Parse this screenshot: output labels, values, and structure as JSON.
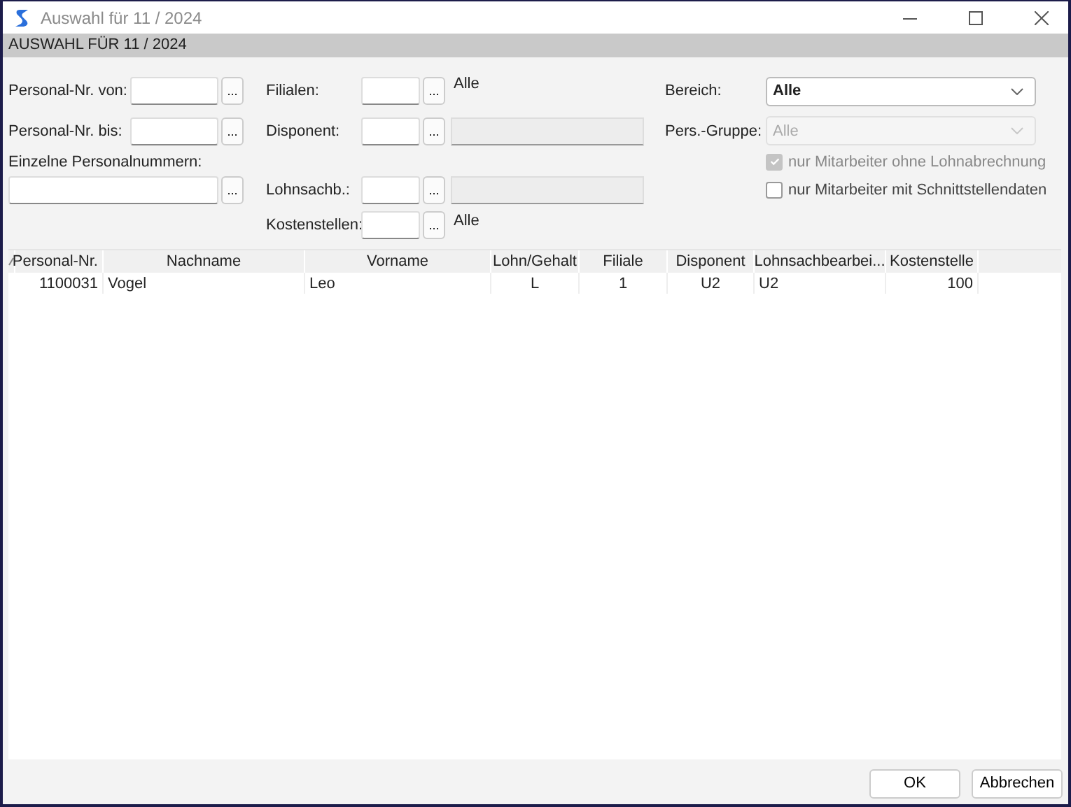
{
  "window": {
    "title": "Auswahl für 11 / 2024"
  },
  "header": "AUSWAHL FÜR 11 / 2024",
  "left_fields": [
    {
      "label": "Personal-Nr. von:",
      "browse": "..."
    },
    {
      "label": "Personal-Nr. bis:",
      "browse": "..."
    },
    {
      "label": "Einzelne Personalnummern:",
      "browse": "..."
    }
  ],
  "middle_fields": [
    {
      "label": "Filialen:",
      "browse": "...",
      "kind": "note",
      "note": "Alle"
    },
    {
      "label": "Disponent:",
      "browse": "...",
      "kind": "detail"
    },
    {
      "label": "Lohnsachb.:",
      "browse": "...",
      "kind": "detail"
    },
    {
      "label": "Kostenstellen:",
      "browse": "...",
      "kind": "note",
      "note": "Alle"
    }
  ],
  "selects": [
    {
      "label": "Bereich:",
      "value": "Alle",
      "disabled": false
    },
    {
      "label": "Pers.-Gruppe:",
      "value": "Alle",
      "disabled": true
    }
  ],
  "checkboxes": [
    {
      "label": "nur Mitarbeiter ohne Lohnabrechnung",
      "checked": true,
      "disabled": true
    },
    {
      "label": "nur Mitarbeiter mit Schnittstellendaten",
      "checked": false,
      "disabled": false
    }
  ],
  "table": {
    "columns": [
      "Personal-Nr.",
      "Nachname",
      "Vorname",
      "Lohn/Gehalt",
      "Filiale",
      "Disponent",
      "Lohnsachbearbei...",
      "Kostenstelle"
    ],
    "rows": [
      [
        "1100031",
        "Vogel",
        "Leo",
        "L",
        "1",
        "U2",
        "U2",
        "100"
      ]
    ]
  },
  "buttons": [
    "OK",
    "Abbrechen"
  ]
}
